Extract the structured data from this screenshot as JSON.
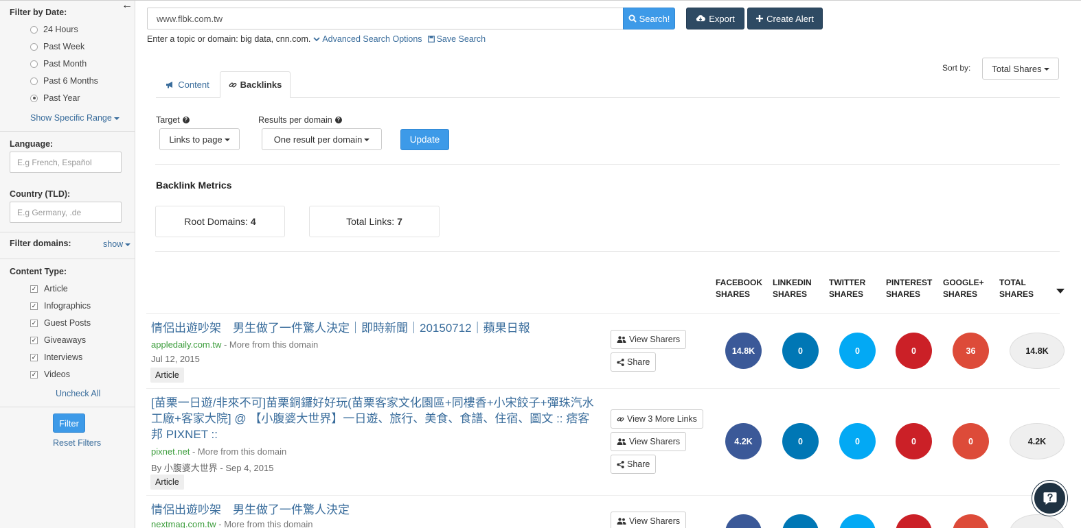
{
  "sidebar": {
    "filter_by_date_label": "Filter by Date:",
    "date_options": [
      "24 Hours",
      "Past Week",
      "Past Month",
      "Past 6 Months",
      "Past Year"
    ],
    "selected_date": "Past Year",
    "show_specific_range": "Show Specific Range",
    "language_label": "Language:",
    "language_placeholder": "E.g French, Español",
    "country_label": "Country (TLD):",
    "country_placeholder": "E.g Germany, .de",
    "filter_domains_label": "Filter domains:",
    "filter_domains_toggle": "show",
    "content_type_label": "Content Type:",
    "content_types": [
      "Article",
      "Infographics",
      "Guest Posts",
      "Giveaways",
      "Interviews",
      "Videos"
    ],
    "uncheck_all": "Uncheck All",
    "filter_button": "Filter",
    "reset_filters": "Reset Filters"
  },
  "search": {
    "value": "www.flbk.com.tw",
    "button": "Search!",
    "export": "Export",
    "create_alert": "Create Alert",
    "hint_text": "Enter a topic or domain: big data, cnn.com.",
    "advanced": "Advanced Search Options",
    "save": "Save Search"
  },
  "sort": {
    "label": "Sort by:",
    "value": "Total Shares"
  },
  "tabs": [
    {
      "label": "Content",
      "active": false
    },
    {
      "label": "Backlinks",
      "active": true
    }
  ],
  "controls": {
    "target_label": "Target",
    "target_value": "Links to page",
    "results_label": "Results per domain",
    "results_value": "One result per domain",
    "update": "Update"
  },
  "metrics": {
    "title": "Backlink Metrics",
    "root_domains_label": "Root Domains:",
    "root_domains": "4",
    "total_links_label": "Total Links:",
    "total_links": "7"
  },
  "columns": [
    [
      "FACEBOOK",
      "SHARES"
    ],
    [
      "LINKEDIN",
      "SHARES"
    ],
    [
      "TWITTER",
      "SHARES"
    ],
    [
      "PINTEREST",
      "SHARES"
    ],
    [
      "GOOGLE+",
      "SHARES"
    ],
    [
      "TOTAL SHARES",
      ""
    ]
  ],
  "colors": {
    "facebook": "#3b5998",
    "linkedin": "#0077b5",
    "twitter": "#03a9f4",
    "pinterest": "#cb2027",
    "google": "#dd4b39",
    "accent": "#3d9ae8",
    "dark_button": "#2e4a63"
  },
  "results": [
    {
      "title": "情侶出遊吵架　男生做了一件驚人決定｜即時新聞｜20150712｜蘋果日報",
      "domain": "appledaily.com.tw",
      "more": " - More from this domain",
      "meta": "Jul 12, 2015",
      "tag": "Article",
      "view_links": "",
      "view_sharers": "View Sharers",
      "share": "Share",
      "facebook": "14.8K",
      "linkedin": "0",
      "twitter": "0",
      "pinterest": "0",
      "google": "36",
      "total": "14.8K"
    },
    {
      "title": "[苗栗一日遊/非來不可]苗栗銅鑼好好玩(苗栗客家文化園區+同樓香+小宋餃子+彈珠汽水工廠+客家大院] @ 【小腹婆大世界】一日遊、旅行、美食、食譜、住宿、圖文 :: 痞客邦 PIXNET ::",
      "domain": "pixnet.net",
      "more": " - More from this domain",
      "meta": "By 小腹婆大世界 - Sep 4, 2015",
      "tag": "Article",
      "view_links": "View 3 More Links",
      "view_sharers": "View Sharers",
      "share": "Share",
      "facebook": "4.2K",
      "linkedin": "0",
      "twitter": "0",
      "pinterest": "0",
      "google": "0",
      "total": "4.2K"
    },
    {
      "title": "情侶出遊吵架　男生做了一件驚人決定",
      "domain": "nextmag.com.tw",
      "more": " - More from this domain",
      "view_sharers": "View Sharers"
    }
  ]
}
